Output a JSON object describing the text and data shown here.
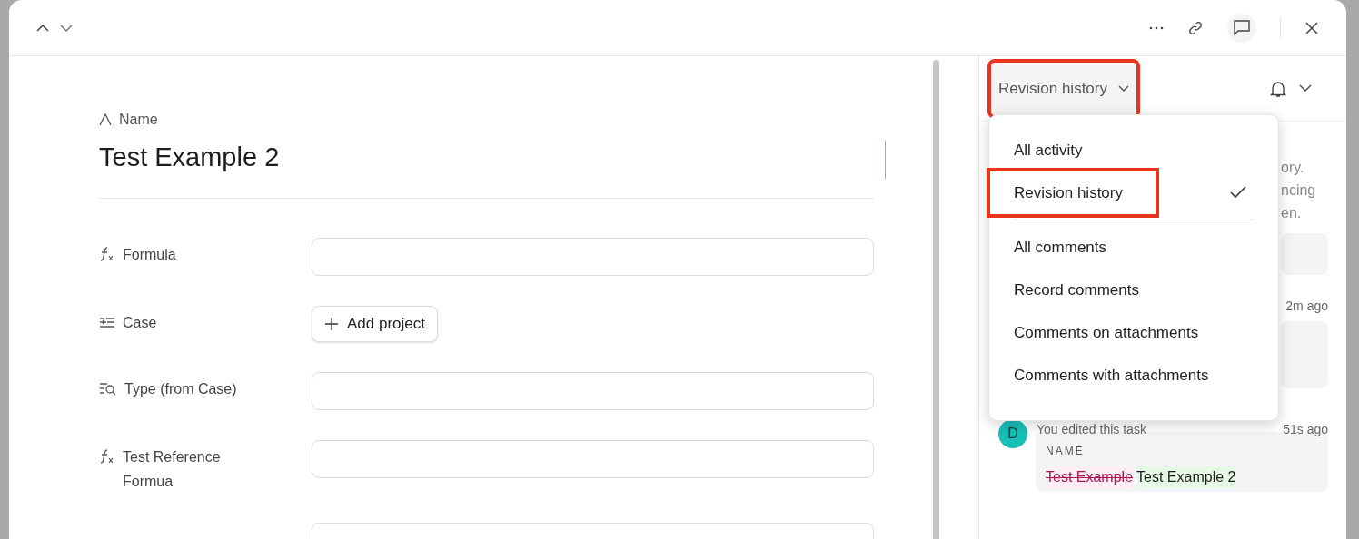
{
  "record": {
    "title_label": "Name",
    "title": "Test Example 2",
    "fields": [
      {
        "kind": "formula",
        "label": "Formula"
      },
      {
        "kind": "link",
        "label": "Case",
        "button_label": "Add project"
      },
      {
        "kind": "lookup",
        "label": "Type (from Case)"
      },
      {
        "kind": "formula",
        "label": "Test Reference Formua"
      },
      {
        "kind": "blank"
      }
    ]
  },
  "activity": {
    "filter": {
      "label": "Revision history",
      "annotated": true
    },
    "menu_groups": [
      [
        {
          "label": "All activity",
          "selected": false,
          "annotated": false
        },
        {
          "label": "Revision history",
          "selected": true,
          "annotated": true
        }
      ],
      [
        {
          "label": "All comments",
          "selected": false,
          "annotated": false
        },
        {
          "label": "Record comments",
          "selected": false,
          "annotated": false
        },
        {
          "label": "Comments on attachments",
          "selected": false,
          "annotated": false
        },
        {
          "label": "Comments with attachments",
          "selected": false,
          "annotated": false
        }
      ]
    ],
    "note_lines": [
      "ory.",
      "ncing",
      "en."
    ],
    "events": [
      {
        "time": "2m ago"
      },
      {
        "avatar": "D",
        "text": "You edited this task",
        "time": "51s ago",
        "field": "NAME",
        "removed": "Test Example",
        "added": "Test Example 2"
      }
    ]
  }
}
